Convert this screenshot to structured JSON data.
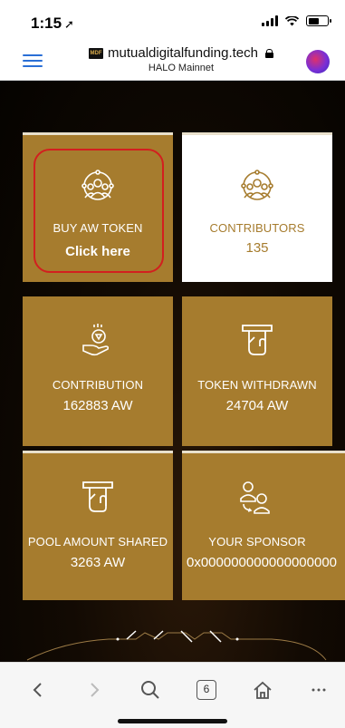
{
  "status_bar": {
    "time": "1:15",
    "location_glyph": "➚"
  },
  "browser": {
    "favicon_text": "MDF",
    "url": "mutualdigitalfunding.tech",
    "network": "HALO Mainnet",
    "tab_count": "6"
  },
  "tiles": {
    "buy": {
      "label": "BUY AW TOKEN",
      "cta": "Click here"
    },
    "contributors": {
      "label": "CONTRIBUTORS",
      "value": "135"
    },
    "contribution": {
      "label": "CONTRIBUTION",
      "value": "162883 AW"
    },
    "withdrawn": {
      "label": "TOKEN WITHDRAWN",
      "value": "24704 AW"
    },
    "pool": {
      "label": "POOL AMOUNT SHARED",
      "value": "3263 AW"
    },
    "sponsor": {
      "label": "YOUR SPONSOR",
      "value": "0x000000000000000000"
    }
  },
  "colors": {
    "tile_gold": "#a67c2e",
    "tile_white": "#ffffff",
    "highlight_red": "#d21f1f",
    "menu_blue": "#2a6fd6"
  },
  "icons": {
    "menu": "hamburger-icon",
    "lock": "lock-icon",
    "buy": "team-network-icon",
    "contributors": "team-network-icon",
    "contribution": "coin-hand-icon",
    "withdrawn": "atm-withdraw-icon",
    "pool": "atm-withdraw-icon",
    "sponsor": "sponsor-referral-icon",
    "back": "chevron-left-icon",
    "forward": "chevron-right-icon",
    "search": "search-icon",
    "tabs": "tabs-icon",
    "home": "home-icon",
    "more": "more-icon"
  }
}
